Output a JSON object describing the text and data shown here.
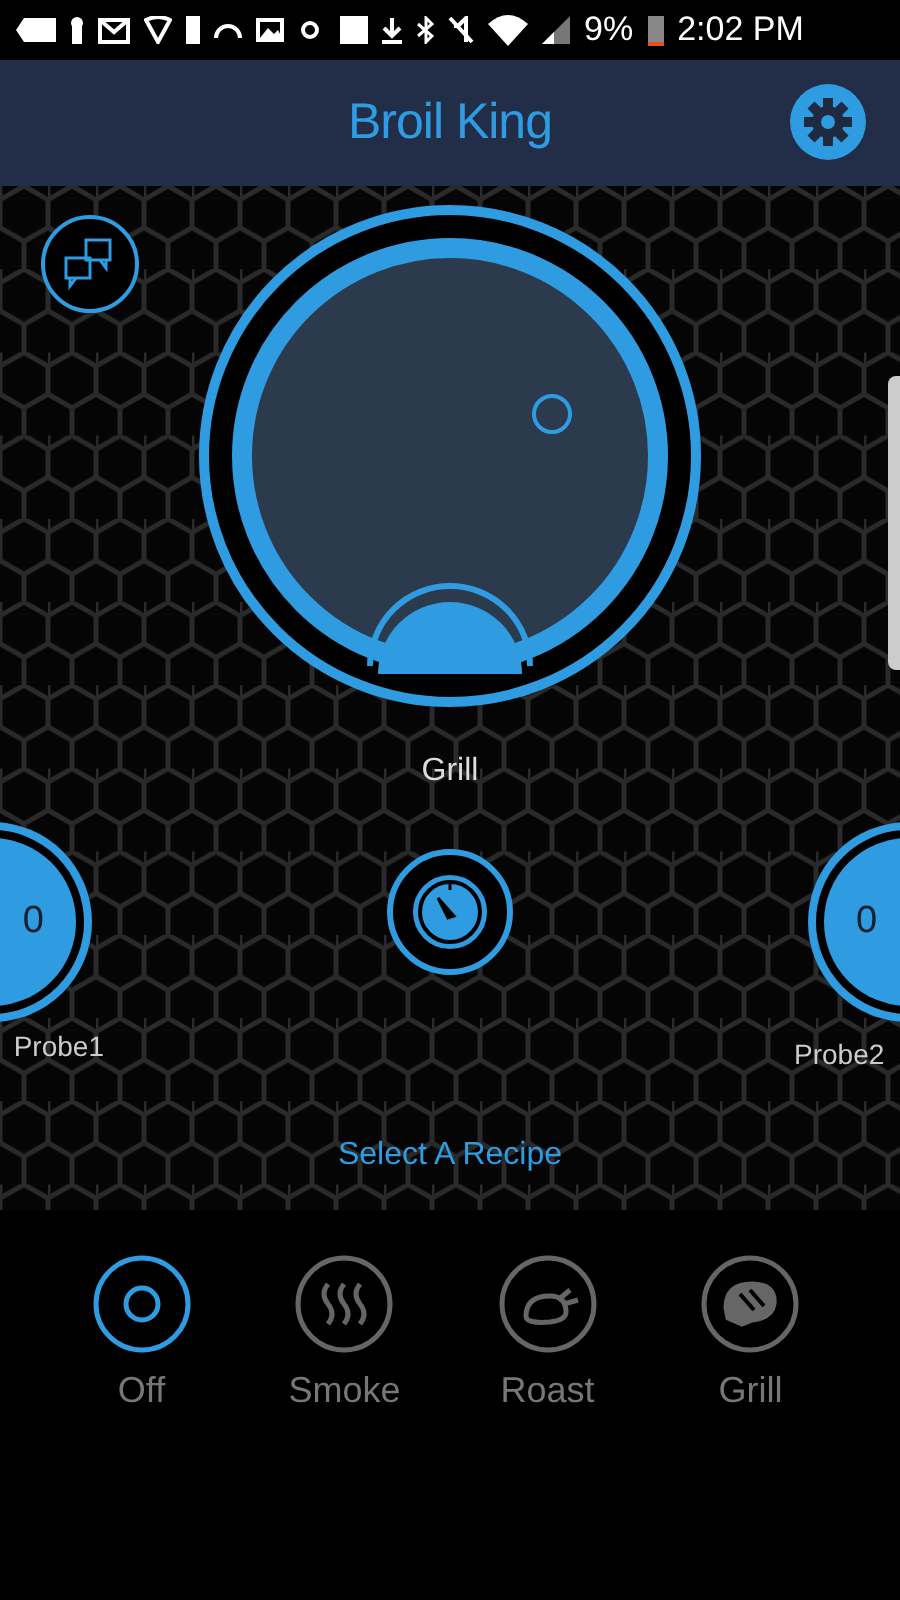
{
  "status_bar": {
    "battery": "9%",
    "time": "2:02 PM"
  },
  "header": {
    "title": "Broil King"
  },
  "dial": {
    "label": "Grill"
  },
  "probes": [
    {
      "label": "Probe1",
      "value": "0"
    },
    {
      "label": "Probe2",
      "value": "0"
    }
  ],
  "recipe_link": "Select A Recipe",
  "modes": [
    {
      "label": "Off",
      "kind": "off",
      "selected": true
    },
    {
      "label": "Smoke",
      "kind": "smoke",
      "selected": false
    },
    {
      "label": "Roast",
      "kind": "roast",
      "selected": false
    },
    {
      "label": "Grill",
      "kind": "grill",
      "selected": false
    }
  ]
}
